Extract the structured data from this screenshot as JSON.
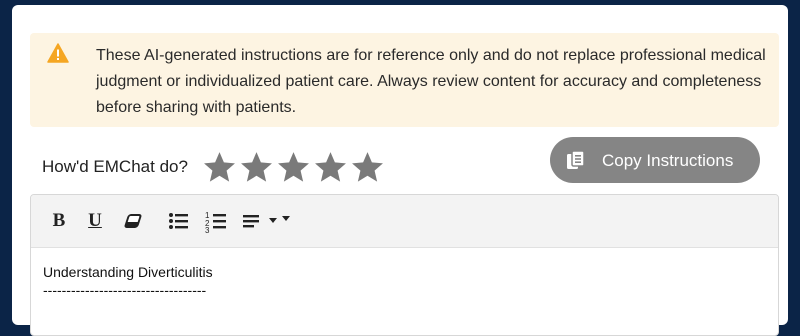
{
  "alert": {
    "icon": "warning-triangle-icon",
    "color": "#f5a623",
    "text": "These AI-generated instructions are for reference only and do not replace professional medical judgment or individualized patient care. Always review content for accuracy and completeness before sharing with patients."
  },
  "rating": {
    "label": "How'd EMChat do?",
    "max_stars": 5,
    "selected": 0,
    "star_color": "#7a7a7a"
  },
  "copy_button": {
    "label": "Copy Instructions",
    "icon": "copy-icon"
  },
  "toolbar": {
    "bold_label": "B",
    "underline_label": "U",
    "items": [
      "bold",
      "underline",
      "clear-format",
      "bulleted-list",
      "numbered-list",
      "align"
    ]
  },
  "editor": {
    "title": "Understanding Diverticulitis",
    "underline": "-----------------------------------"
  },
  "colors": {
    "background": "#0b2447",
    "alert_background": "#fdf4e2",
    "button_background": "#858585"
  }
}
